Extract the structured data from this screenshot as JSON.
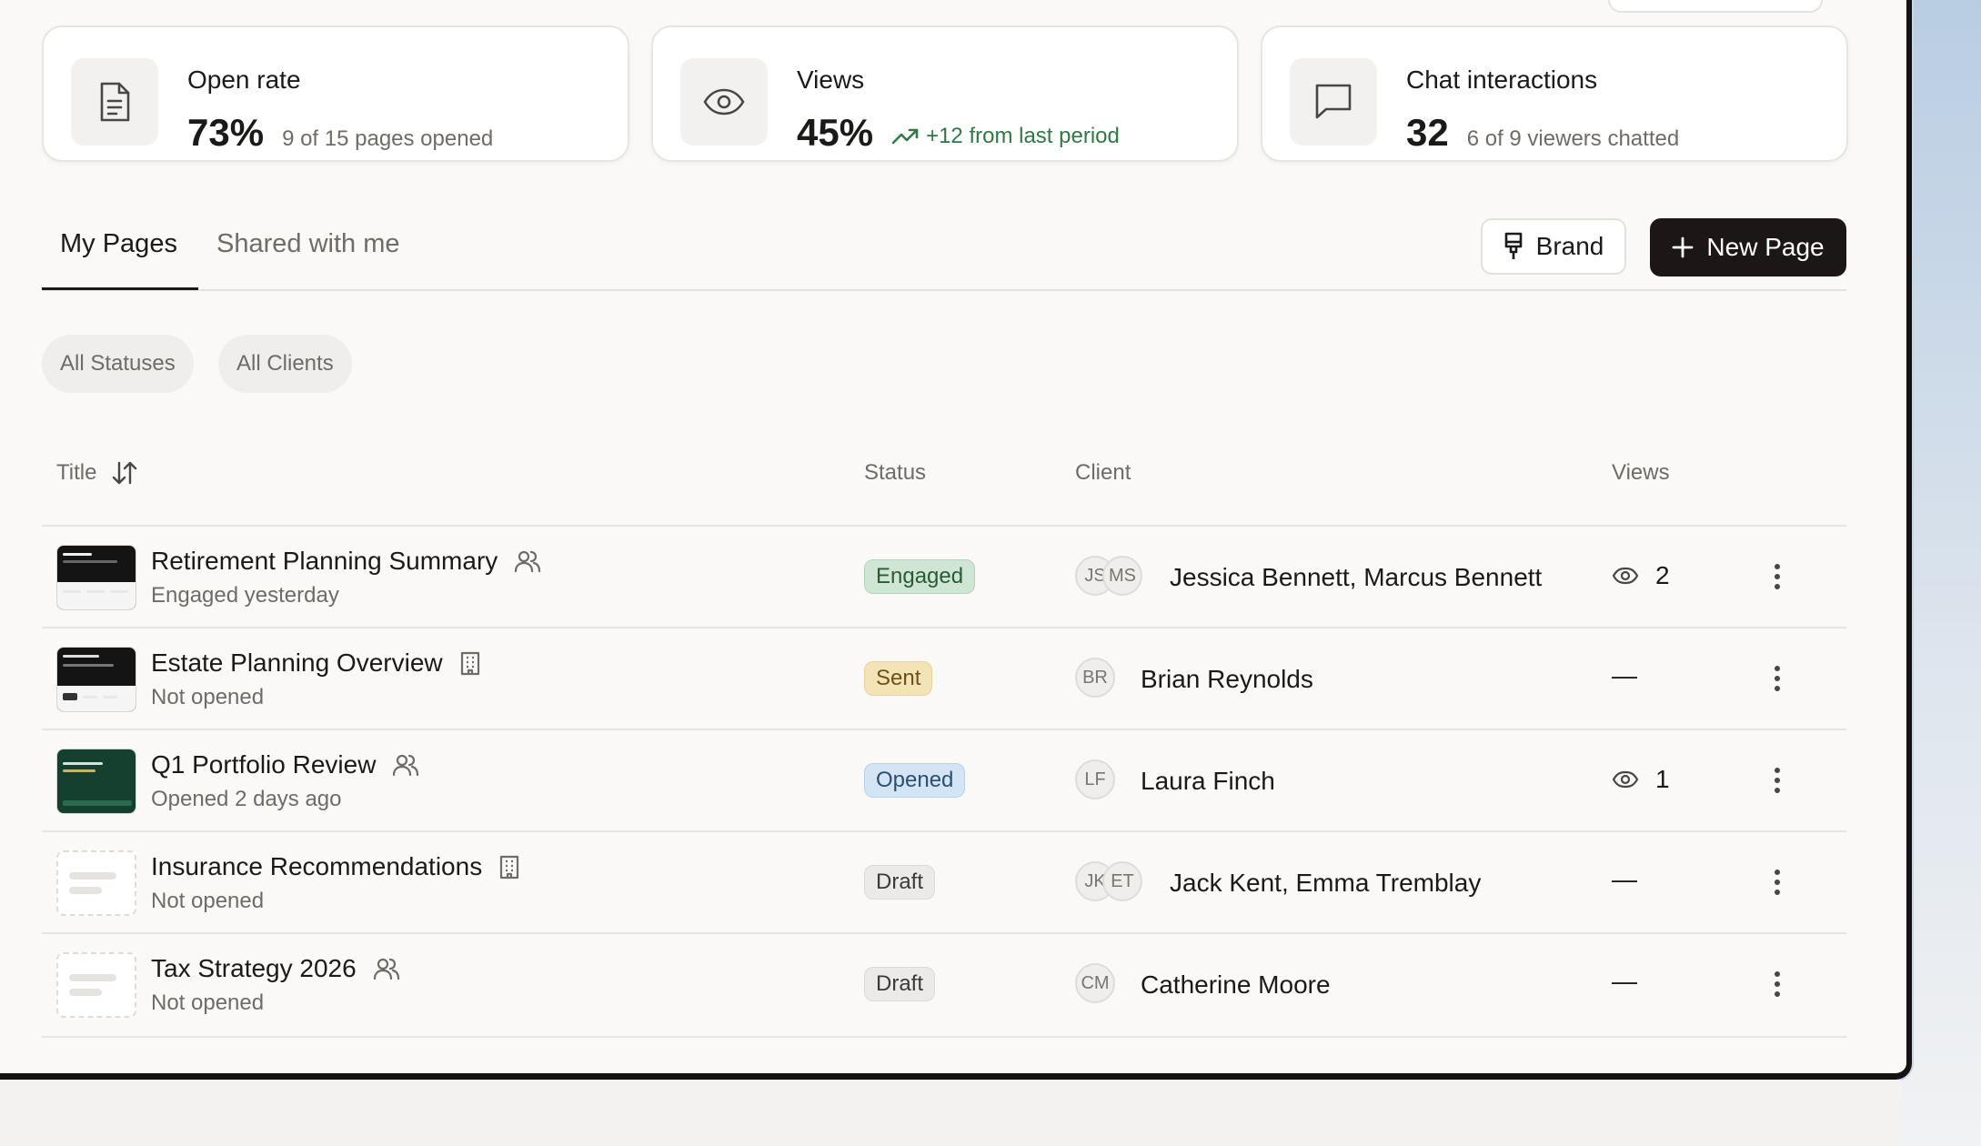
{
  "stats": [
    {
      "label": "Open rate",
      "value": "73%",
      "sub": "9 of 15 pages opened",
      "icon": "document-icon"
    },
    {
      "label": "Views",
      "value": "45%",
      "sub": "+12 from last period",
      "icon": "eye-icon"
    },
    {
      "label": "Chat interactions",
      "value": "32",
      "sub": "6 of 9 viewers chatted",
      "icon": "chat-bubble-icon"
    }
  ],
  "tabs": [
    {
      "label": "My Pages",
      "active": true
    },
    {
      "label": "Shared with me",
      "active": false
    }
  ],
  "toolbar": {
    "brand_label": "Brand",
    "new_page_label": "New Page"
  },
  "filters": [
    "All Statuses",
    "All Clients"
  ],
  "table": {
    "columns": {
      "title": "Title",
      "status": "Status",
      "client": "Client",
      "views": "Views"
    },
    "rows": [
      {
        "title": "Retirement Planning Summary",
        "type_icon": "people-icon",
        "subtitle": "Engaged yesterday",
        "status": "Engaged",
        "initials": [
          "JS",
          "MS"
        ],
        "client": "Jessica Bennett, Marcus Bennett",
        "views": "2",
        "thumb": "dark"
      },
      {
        "title": "Estate Planning Overview",
        "type_icon": "building-icon",
        "subtitle": "Not opened",
        "status": "Sent",
        "initials": [
          "BR"
        ],
        "client": "Brian Reynolds",
        "views": "—",
        "thumb": "dark"
      },
      {
        "title": "Q1 Portfolio Review",
        "type_icon": "people-icon",
        "subtitle": "Opened 2 days ago",
        "status": "Opened",
        "initials": [
          "LF"
        ],
        "client": "Laura Finch",
        "views": "1",
        "thumb": "green"
      },
      {
        "title": "Insurance Recommendations",
        "type_icon": "building-icon",
        "subtitle": "Not opened",
        "status": "Draft",
        "initials": [
          "JK",
          "ET"
        ],
        "client": "Jack Kent, Emma Tremblay",
        "views": "—",
        "thumb": "empty"
      },
      {
        "title": "Tax Strategy 2026",
        "type_icon": "people-icon",
        "subtitle": "Not opened",
        "status": "Draft",
        "initials": [
          "CM"
        ],
        "client": "Catherine Moore",
        "views": "—",
        "thumb": "empty"
      }
    ]
  },
  "colors": {
    "accent_dark": "#1c1716",
    "positive_green": "#2f7a43",
    "engaged": "#cfe6d4",
    "sent": "#f4e3b6",
    "opened": "#d3e4f4",
    "draft": "#ebeae8"
  }
}
